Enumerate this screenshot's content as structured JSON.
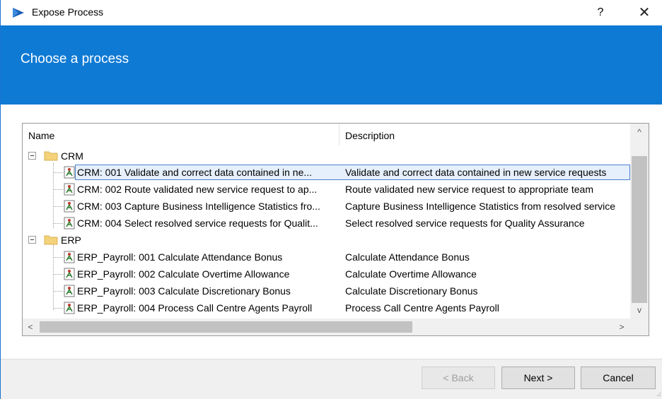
{
  "window": {
    "title": "Expose Process",
    "help_label": "?",
    "close_label": "✕"
  },
  "banner": {
    "title": "Choose a process"
  },
  "columns": {
    "name": "Name",
    "description": "Description"
  },
  "groups": [
    {
      "name": "CRM",
      "items": [
        {
          "name": "CRM: 001 Validate and correct data contained in ne...",
          "description": "Validate and correct data contained in new service requests",
          "selected": true
        },
        {
          "name": "CRM: 002 Route validated new service request to ap...",
          "description": "Route validated new service request to appropriate team"
        },
        {
          "name": "CRM: 003 Capture Business Intelligence Statistics fro...",
          "description": "Capture Business Intelligence Statistics from resolved service"
        },
        {
          "name": "CRM: 004 Select resolved service requests for Qualit...",
          "description": "Select resolved service requests for Quality Assurance"
        }
      ]
    },
    {
      "name": "ERP",
      "items": [
        {
          "name": "ERP_Payroll: 001 Calculate Attendance Bonus",
          "description": "Calculate Attendance Bonus"
        },
        {
          "name": "ERP_Payroll: 002 Calculate Overtime Allowance",
          "description": "Calculate Overtime Allowance"
        },
        {
          "name": "ERP_Payroll: 003 Calculate Discretionary Bonus",
          "description": "Calculate Discretionary Bonus"
        },
        {
          "name": "ERP_Payroll: 004 Process Call Centre Agents Payroll",
          "description": "Process Call Centre Agents Payroll"
        }
      ]
    }
  ],
  "scroll": {
    "up": "^",
    "down": "v",
    "left": "<",
    "right": ">"
  },
  "buttons": {
    "back": "< Back",
    "next": "Next >",
    "cancel": "Cancel"
  },
  "colors": {
    "accent": "#0f7ad4",
    "selection_border": "#4a7fd1",
    "selection_fill": "#e6f0fc"
  }
}
